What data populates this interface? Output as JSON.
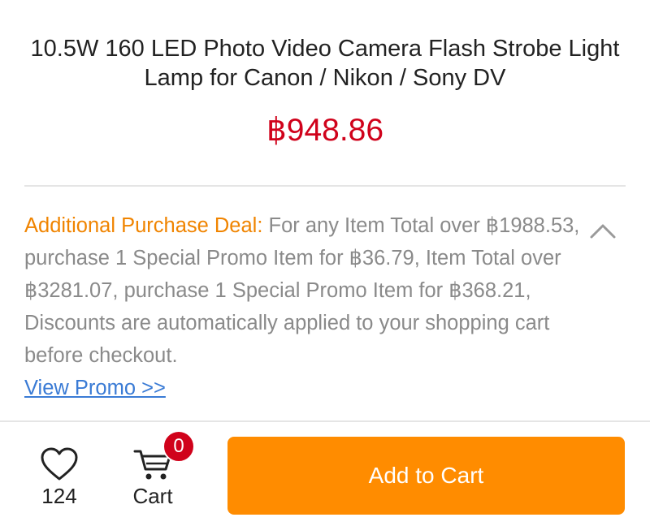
{
  "product": {
    "title": "10.5W 160 LED Photo Video Camera Flash Strobe Light Lamp for Canon / Nikon / Sony DV",
    "price": "฿948.86"
  },
  "promo": {
    "deal_label": "Additional Purchase Deal:",
    "deal_text": " For any Item Total over ฿1988.53, purchase 1 Special Promo Item for ฿36.79, Item Total over ฿3281.07, purchase 1 Special Promo Item for ฿368.21, Discounts are automatically applied to your shopping cart before checkout.",
    "view_promo_label": "View Promo >>",
    "collapse_icon": "chevron-up-icon"
  },
  "bottom_bar": {
    "favorite_icon": "heart-icon",
    "favorite_count": "124",
    "cart_icon": "cart-icon",
    "cart_label": "Cart",
    "cart_badge_count": "0",
    "add_to_cart_label": "Add to Cart"
  },
  "colors": {
    "price": "#d0021b",
    "deal_label": "#f08400",
    "link": "#3a7bd5",
    "primary_button": "#ff8c00",
    "badge": "#d0021b"
  }
}
